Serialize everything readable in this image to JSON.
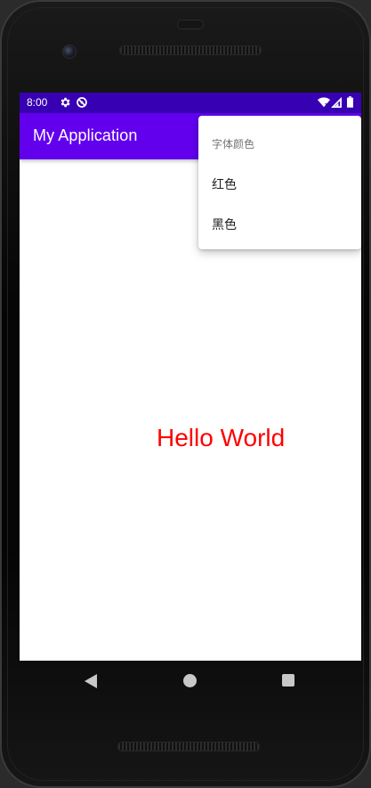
{
  "status_bar": {
    "time": "8:00",
    "icons": [
      "gear-icon",
      "sync-off-icon",
      "wifi-icon",
      "cell-signal-icon",
      "battery-icon"
    ],
    "background_color": "#3700b3"
  },
  "app_bar": {
    "title": "My Application",
    "background_color": "#6200ee"
  },
  "content": {
    "hello_text": "Hello World",
    "hello_color": "#ff0000"
  },
  "overflow_menu": {
    "header": "字体颜色",
    "items": [
      {
        "label": "红色"
      },
      {
        "label": "黑色"
      }
    ]
  },
  "navigation_bar": {
    "buttons": [
      "back-icon",
      "home-icon",
      "recents-icon"
    ]
  }
}
